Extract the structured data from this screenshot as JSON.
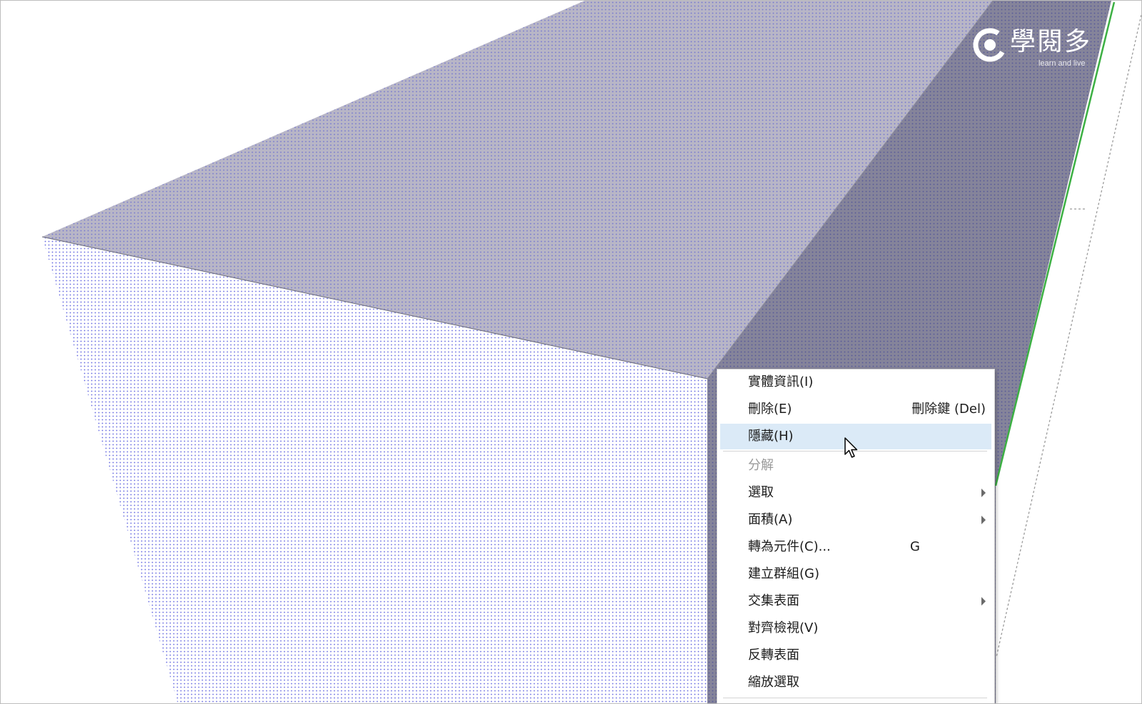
{
  "app": {
    "name": "SketchUp",
    "canvas": "3d-model-viewport"
  },
  "watermark": {
    "brand": "學閱多",
    "tagline": "learn and live"
  },
  "context_menu": {
    "items": [
      {
        "label": "實體資訊(I)",
        "shortcut": "",
        "submenu": false,
        "disabled": false,
        "highlighted": false
      },
      {
        "label": "刪除(E)",
        "shortcut": "刪除鍵 (Del)",
        "submenu": false,
        "disabled": false,
        "highlighted": false
      },
      {
        "label": "隱藏(H)",
        "shortcut": "",
        "submenu": false,
        "disabled": false,
        "highlighted": true
      },
      {
        "label": "分解",
        "shortcut": "",
        "submenu": false,
        "disabled": true,
        "highlighted": false
      },
      {
        "label": "選取",
        "shortcut": "",
        "submenu": true,
        "disabled": false,
        "highlighted": false
      },
      {
        "label": "面積(A)",
        "shortcut": "",
        "submenu": true,
        "disabled": false,
        "highlighted": false
      },
      {
        "label": "轉為元件(C)...",
        "shortcut": "G",
        "submenu": false,
        "disabled": false,
        "highlighted": false
      },
      {
        "label": "建立群組(G)",
        "shortcut": "",
        "submenu": false,
        "disabled": false,
        "highlighted": false
      },
      {
        "label": "交集表面",
        "shortcut": "",
        "submenu": true,
        "disabled": false,
        "highlighted": false
      },
      {
        "label": "對齊檢視(V)",
        "shortcut": "",
        "submenu": false,
        "disabled": false,
        "highlighted": false
      },
      {
        "label": "反轉表面",
        "shortcut": "",
        "submenu": false,
        "disabled": false,
        "highlighted": false
      },
      {
        "label": "縮放選取",
        "shortcut": "",
        "submenu": false,
        "disabled": false,
        "highlighted": false
      }
    ]
  },
  "colors": {
    "selection_dots": "#3a40d8",
    "top_face": "#b5b3c4",
    "side_face_dark": "#7c7b8a",
    "front_face": "#ffffff",
    "green_axis": "#3cb043",
    "menu_highlight": "#dbeaf7"
  }
}
